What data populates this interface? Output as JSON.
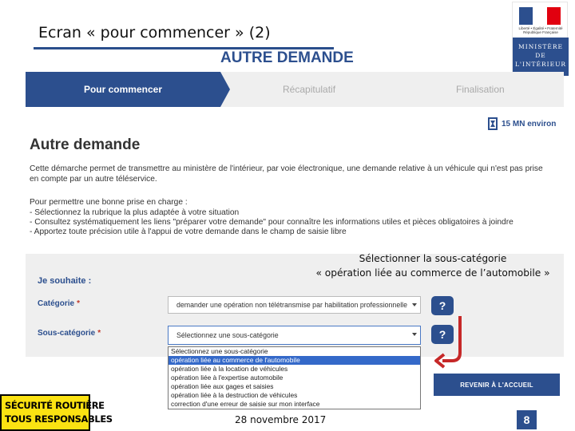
{
  "slide": {
    "title": "Ecran « pour commencer » (2)",
    "date": "28 novembre 2017",
    "page_number": "8"
  },
  "header": {
    "flag_text": "Liberté • Égalité • Fraternité République Française",
    "ministry_lines": [
      "MINISTÈRE",
      "DE",
      "L'INTÉRIEUR"
    ],
    "page_heading": "AUTRE DEMANDE"
  },
  "steps": [
    {
      "label": "Pour commencer",
      "state": "active"
    },
    {
      "label": "Récapitulatif",
      "state": "inactive"
    },
    {
      "label": "Finalisation",
      "state": "inactive"
    }
  ],
  "timer": {
    "label": "15 MN environ",
    "icon": "hourglass-icon"
  },
  "form": {
    "heading": "Autre demande",
    "intro": "Cette démarche permet de transmettre au ministère de l'intérieur, par voie électronique, une demande relative à un véhicule qui n'est pas prise en compte par un autre téléservice.",
    "help_title": "Pour permettre une bonne prise en charge :",
    "help_items": [
      "- Sélectionnez la rubrique la plus adaptée à votre situation",
      "- Consultez systématiquement les liens \"préparer votre demande\" pour connaître les informations utiles et pièces obligatoires à joindre",
      "- Apportez toute précision utile à l'appui de votre demande dans le champ de saisie libre"
    ],
    "want_label": "Je souhaite :",
    "category_label": "Catégorie",
    "category_value": "demander une opération non télétransmise par habilitation professionnelle",
    "subcategory_label": "Sous-catégorie",
    "subcategory_value": "Sélectionnez une sous-catégorie",
    "required_mark": "*",
    "help_button": "?",
    "dropdown_options": [
      "Sélectionnez une sous-catégorie",
      "opération liée au commerce de l'automobile",
      "opération liée à la location de véhicules",
      "opération liée à l'expertise automobile",
      "opération liée aux gages et saisies",
      "opération liée à la destruction de véhicules",
      "correction d'une erreur de saisie sur mon interface"
    ],
    "selected_option_index": 1
  },
  "callout": {
    "line1": "Sélectionner la sous-catégorie",
    "line2": "« opération liée au commerce de l’automobile »"
  },
  "home_button": "REVENIR À L'ACCUEIL",
  "road_safety_logo": [
    "SÉCURITÉ ROUTIÈRE",
    "TOUS RESPONSABLES"
  ],
  "colors": {
    "primary": "#2c4f8e",
    "panel": "#efefef",
    "selected_option": "#3469c9",
    "arrow": "#c62828",
    "road_logo_bg": "#fbe212"
  }
}
